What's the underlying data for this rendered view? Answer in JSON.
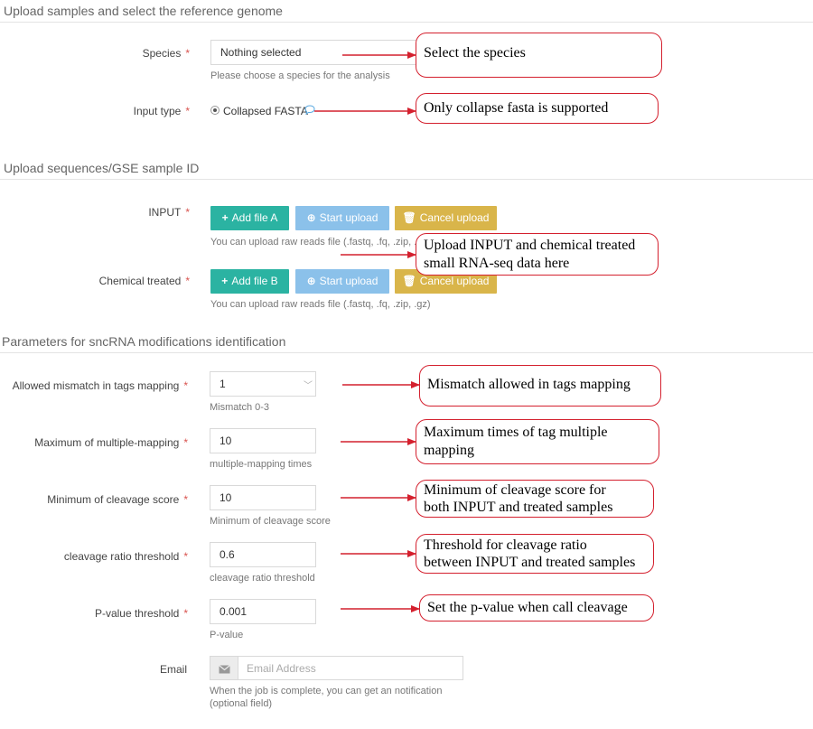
{
  "sections": {
    "upload_genome": "Upload samples and select the reference genome",
    "upload_sequences": "Upload sequences/GSE sample ID",
    "parameters": "Parameters for sncRNA modifications identification"
  },
  "required_mark": "*",
  "species": {
    "label": "Species",
    "value": "Nothing selected",
    "help": "Please choose a species for the analysis"
  },
  "input_type": {
    "label": "Input type",
    "option": "Collapsed FASTA"
  },
  "input_upload": {
    "label": "INPUT",
    "add": "Add file A",
    "start": "Start upload",
    "cancel": "Cancel upload",
    "help": "You can upload raw reads file (.fastq, .fq, .zip, .gz)"
  },
  "chem_upload": {
    "label": "Chemical treated",
    "add": "Add file B",
    "start": "Start upload",
    "cancel": "Cancel upload",
    "help": "You can upload raw reads file (.fastq, .fq, .zip, .gz)"
  },
  "mismatch": {
    "label": "Allowed mismatch in tags mapping",
    "value": "1",
    "help": "Mismatch 0-3"
  },
  "multi_mapping": {
    "label": "Maximum of multiple-mapping",
    "value": "10",
    "help": "multiple-mapping times"
  },
  "cleavage_score": {
    "label": "Minimum of cleavage score",
    "value": "10",
    "help": "Minimum of cleavage score"
  },
  "cleavage_ratio": {
    "label": "cleavage ratio threshold",
    "value": "0.6",
    "help": "cleavage ratio threshold"
  },
  "pvalue": {
    "label": "P-value threshold",
    "value": "0.001",
    "help": "P-value"
  },
  "email": {
    "label": "Email",
    "placeholder": "Email Address",
    "help_line1": "When the job is complete, you can get an notification",
    "help_line2": "(optional field)"
  },
  "callouts": {
    "species": "Select the species",
    "input_type": "Only collapse fasta is supported",
    "upload_line1": "Upload INPUT and chemical treated",
    "upload_line2": "small RNA-seq data here",
    "mismatch": "Mismatch allowed in tags mapping",
    "multi_line1": "Maximum times of tag multiple",
    "multi_line2": "mapping",
    "score_line1": "Minimum of cleavage score for",
    "score_line2": "both INPUT and treated samples",
    "ratio_line1": "Threshold for cleavage ratio",
    "ratio_line2": "between INPUT and treated samples",
    "pvalue": "Set the p-value when call cleavage"
  },
  "icons": {
    "plus": "plus-icon",
    "upload": "upload-circle-icon",
    "trash": "trash-icon",
    "comment": "comment-icon",
    "chevron": "chevron-down-icon",
    "envelope": "envelope-icon"
  },
  "colors": {
    "add": "#2bb3a2",
    "start": "#8bc1ea",
    "cancel": "#d9b54a",
    "callout_border": "#d4202e",
    "required": "#d9534f"
  }
}
